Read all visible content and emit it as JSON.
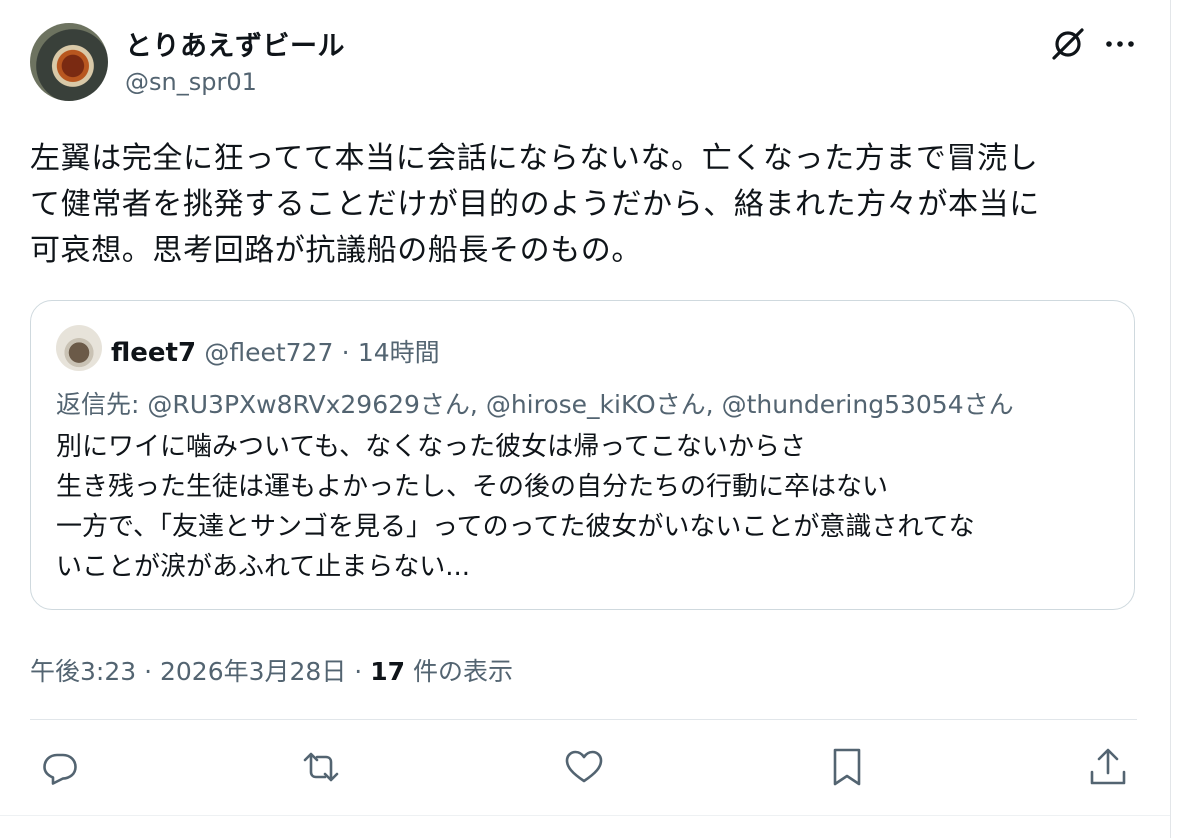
{
  "author": {
    "display_name": "とりあえずビール",
    "handle": "@sn_spr01"
  },
  "post": {
    "lines": [
      "左翼は完全に狂ってて本当に会話にならないな。亡くなった方まで冒涜し",
      "て健常者を挑発することだけが目的のようだから、絡まれた方々が本当に",
      "可哀想。思考回路が抗議船の船長そのもの。"
    ]
  },
  "quoted": {
    "display_name": "fleet7",
    "handle": "@fleet727",
    "separator": "·",
    "time": "14時間",
    "reply_to": "返信先: @RU3PXw8RVx29629さん, @hirose_kiKOさん, @thundering53054さん",
    "lines": [
      "別にワイに噛みついても、なくなった彼女は帰ってこないからさ",
      "生き残った生徒は運もよかったし、その後の自分たちの行動に卒はない",
      "一方で、「友達とサンゴを見る」ってのってた彼女がいないことが意識されてな",
      "いことが涙があふれて止まらない..."
    ]
  },
  "meta": {
    "time": "午後3:23",
    "separator": "·",
    "date": "2026年3月28日",
    "view_count": "17",
    "view_label": "件の表示"
  },
  "icons": {
    "grok": "grok-icon",
    "more": "more-icon",
    "reply": "reply-icon",
    "repost": "repost-icon",
    "like": "heart-icon",
    "bookmark": "bookmark-icon",
    "share": "share-icon"
  },
  "colors": {
    "text": "#0f1419",
    "secondary": "#536471",
    "border": "#cfd9de"
  }
}
